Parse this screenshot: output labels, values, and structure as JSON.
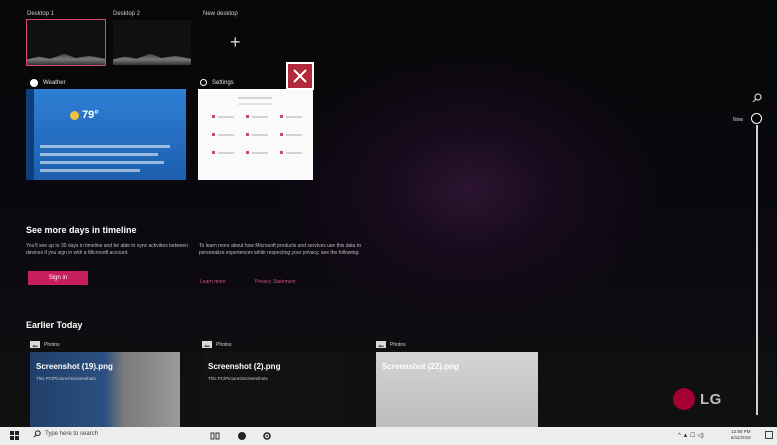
{
  "desktops": [
    {
      "label": "Desktop 1",
      "selected": true
    },
    {
      "label": "Desktop 2",
      "selected": false
    }
  ],
  "new_desktop": {
    "label": "New desktop",
    "icon": "plus-icon",
    "glyph": "+"
  },
  "open_windows": [
    {
      "title": "Weather",
      "icon": "weather-app-icon",
      "temperature": "79°"
    },
    {
      "title": "Settings",
      "icon": "settings-app-icon"
    }
  ],
  "close_icon": "close-icon",
  "timeline_promo": {
    "heading": "See more days in timeline",
    "description": "You'll see up to 30 days in timeline and be able to sync activities between devices if you sign in with a Microsoft account.",
    "signin_label": "Sign in",
    "privacy_description": "To learn more about how Microsoft products and services use this data to personalize experiences while respecting your privacy, see the following:",
    "learn_more_label": "Learn more",
    "privacy_statement_label": "Privacy Statement",
    "accent": "#c51f5d"
  },
  "earlier_section": {
    "heading": "Earlier Today",
    "activities": [
      {
        "app": "Photos",
        "name": "Screenshot (19).png",
        "sub": "This PC\\Pictures\\Screenshots"
      },
      {
        "app": "Photos",
        "name": "Screenshot (2).png",
        "sub": "This PC\\Pictures\\Screenshots"
      },
      {
        "app": "Photos",
        "name": "Screenshot (22).png",
        "sub": "This PC\\Pictures\\Screenshots"
      }
    ]
  },
  "timeline_scrubber": {
    "now_label": "Now",
    "search_icon": "search-icon"
  },
  "brand": {
    "logo_text": "LG",
    "color": "#a50034"
  },
  "taskbar": {
    "search_placeholder": "Type here to search",
    "tray_text": "^ ▲ ☐ ◁)",
    "clock_time": "12:58 PM",
    "clock_date": "6/11/2018"
  }
}
